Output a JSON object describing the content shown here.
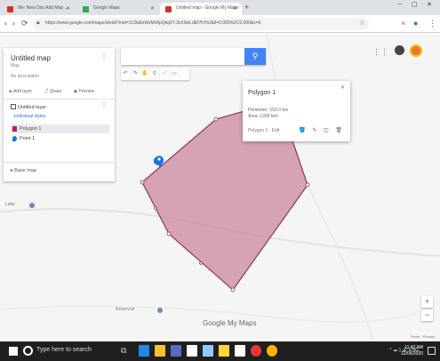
{
  "browser": {
    "tabs": [
      {
        "title": "Me: New Doc Add Map ...",
        "favicon_color": "#d93025",
        "active": false
      },
      {
        "title": "Google Maps",
        "favicon_color": "#34a853",
        "active": false
      },
      {
        "title": "Untitled map - Google My Maps",
        "favicon_color": "#d93025",
        "active": true
      }
    ],
    "new_tab_glyph": "+",
    "window_controls": [
      "–",
      "▢",
      "✕"
    ],
    "url": "https://www.google.com/maps/d/edit?mid=1C8a5nWzMv6pQkq0T-3cX9wLdEf7hYbJ&ll=0.000%2C0.000&z=6",
    "nav_icons": [
      "‹",
      "›",
      "⟳"
    ]
  },
  "mymaps": {
    "map_title": "Untitled map",
    "map_sub": "Map",
    "map_desc": "No description",
    "actions": [
      "Add layer",
      "Share",
      "Preview"
    ],
    "layer_name": "Untitled layer",
    "layer_link": "Individual styles",
    "features": [
      {
        "label": "Polygon 1",
        "color": "#c2185b",
        "selected": true
      },
      {
        "label": "Point 1",
        "color": "#1a73e8",
        "selected": false
      }
    ],
    "base_map_label": "Base map",
    "search_placeholder": "",
    "draw_tools": [
      "↶",
      "↷",
      "✋",
      "⚲",
      "⟋",
      "▭"
    ],
    "infocard": {
      "name": "Polygon 1",
      "measure1": "Perimeter: 150.0 km",
      "measure2": "Area: 1200 km²",
      "footer": "Polygon 1 · Edit",
      "tools": "🪣 ✎ ◫ 🗑"
    },
    "google_logo": "Google My Maps",
    "zoom_in": "+",
    "zoom_out": "−",
    "terms": "Terms · Privacy",
    "map_labels": [
      {
        "text": "Lake"
      },
      {
        "text": "Reservoir"
      }
    ]
  },
  "taskbar": {
    "search_text": "Type here to search",
    "taskview_glyph": "⧉",
    "apps": [
      "#1e88e5",
      "#fbc02d",
      "#5c6bc0",
      "#ffffff",
      "#90caf9",
      "#fdd835",
      "#ffffff",
      "#e53935",
      "#ffb300"
    ],
    "tray_text": "^ ☁ ▯ 🔊 ENG",
    "time": "11:42 AM",
    "date": "12/06/2020"
  },
  "colors": {
    "polygon_fill": "#c9879c",
    "polygon_stroke": "#8e3a52",
    "accent": "#4285f4"
  }
}
